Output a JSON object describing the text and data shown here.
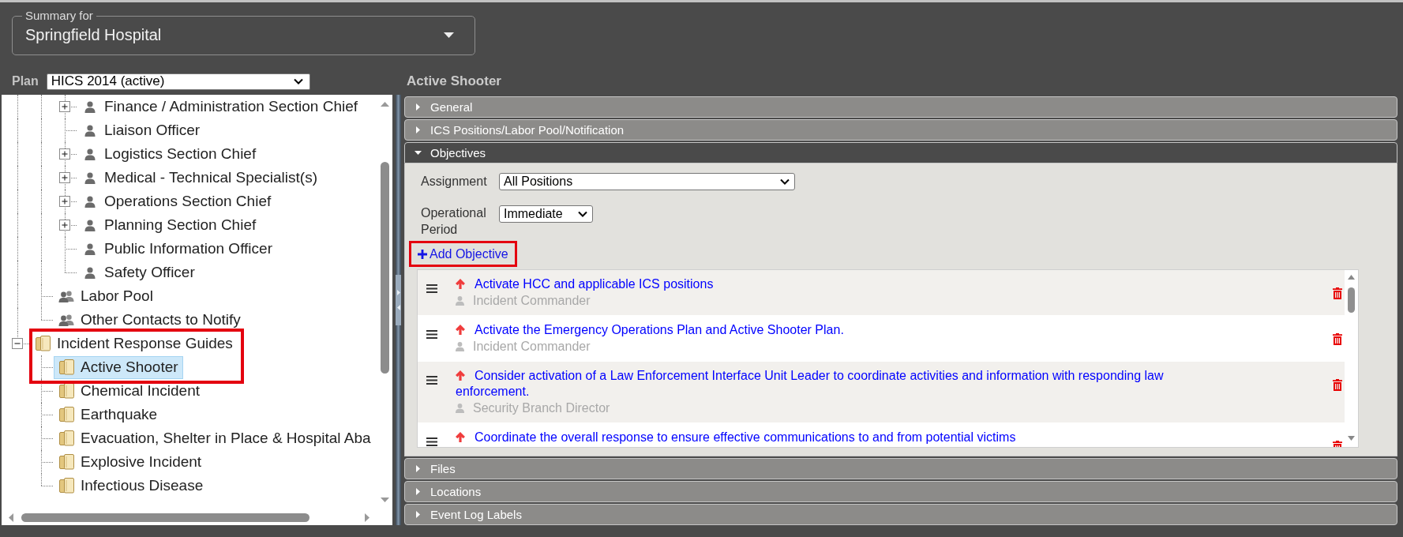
{
  "summary": {
    "label": "Summary for",
    "value": "Springfield Hospital"
  },
  "plan": {
    "label": "Plan",
    "value": "HICS 2014 (active)"
  },
  "tree": [
    {
      "children": [
        {
          "children": [
            {
              "label": "Finance / Administration Section Chief",
              "kind": "person",
              "expanded": false,
              "selected": false,
              "annotated": false
            },
            {
              "label": "Liaison Officer",
              "kind": "person",
              "selected": false,
              "annotated": false
            },
            {
              "label": "Logistics Section Chief",
              "kind": "person",
              "expanded": false,
              "selected": false,
              "annotated": false
            },
            {
              "label": "Medical - Technical Specialist(s)",
              "kind": "person",
              "expanded": false,
              "selected": false,
              "annotated": false
            },
            {
              "label": "Operations Section Chief",
              "kind": "person",
              "expanded": false,
              "selected": false,
              "annotated": false
            },
            {
              "label": "Planning Section Chief",
              "kind": "person",
              "expanded": false,
              "selected": false,
              "annotated": false
            },
            {
              "label": "Public Information Officer",
              "kind": "person",
              "selected": false,
              "annotated": false
            },
            {
              "label": "Safety Officer",
              "kind": "person",
              "selected": false,
              "annotated": false
            }
          ]
        },
        {
          "label": "Labor Pool",
          "kind": "group",
          "selected": false,
          "annotated": false
        },
        {
          "label": "Other Contacts to Notify",
          "kind": "group",
          "selected": false,
          "annotated": false
        }
      ]
    },
    {
      "label": "Incident Response Guides",
      "kind": "guide",
      "expanded": true,
      "selected": false,
      "annotated": true,
      "children": [
        {
          "label": "Active Shooter",
          "kind": "guide",
          "selected": true,
          "annotated": true
        },
        {
          "label": "Chemical Incident",
          "kind": "guide",
          "selected": false,
          "annotated": false
        },
        {
          "label": "Earthquake",
          "kind": "guide",
          "selected": false,
          "annotated": false
        },
        {
          "label": "Evacuation, Shelter in Place & Hospital Aba",
          "kind": "guide",
          "selected": false,
          "annotated": false
        },
        {
          "label": "Explosive Incident",
          "kind": "guide",
          "selected": false,
          "annotated": false
        },
        {
          "label": "Infectious Disease",
          "kind": "guide",
          "selected": false,
          "annotated": false
        }
      ]
    }
  ],
  "title": "Active Shooter",
  "sections": [
    {
      "title": "General",
      "expanded": false
    },
    {
      "title": "ICS Positions/Labor Pool/Notification",
      "expanded": false
    },
    {
      "title": "Objectives",
      "expanded": true,
      "filters": [
        {
          "label": "Assignment",
          "value": "All Positions"
        },
        {
          "label": "Operational Period",
          "value": "Immediate"
        }
      ],
      "add_button": {
        "label": "Add Objective",
        "annotated": true
      },
      "objectives": [
        {
          "title": "Activate HCC and applicable ICS positions",
          "assignee": "Incident Commander"
        },
        {
          "title": "Activate the Emergency Operations Plan and Active Shooter Plan.",
          "assignee": "Incident Commander"
        },
        {
          "title": "Consider activation of a Law Enforcement Interface Unit Leader to coordinate activities and information with responding law enforcement.",
          "assignee": "Security Branch Director"
        },
        {
          "title": "Coordinate the overall response to ensure effective communications to and from potential victims"
        }
      ]
    },
    {
      "title": "Files",
      "expanded": false
    },
    {
      "title": "Locations",
      "expanded": false
    },
    {
      "title": "Event Log Labels",
      "expanded": false
    }
  ]
}
